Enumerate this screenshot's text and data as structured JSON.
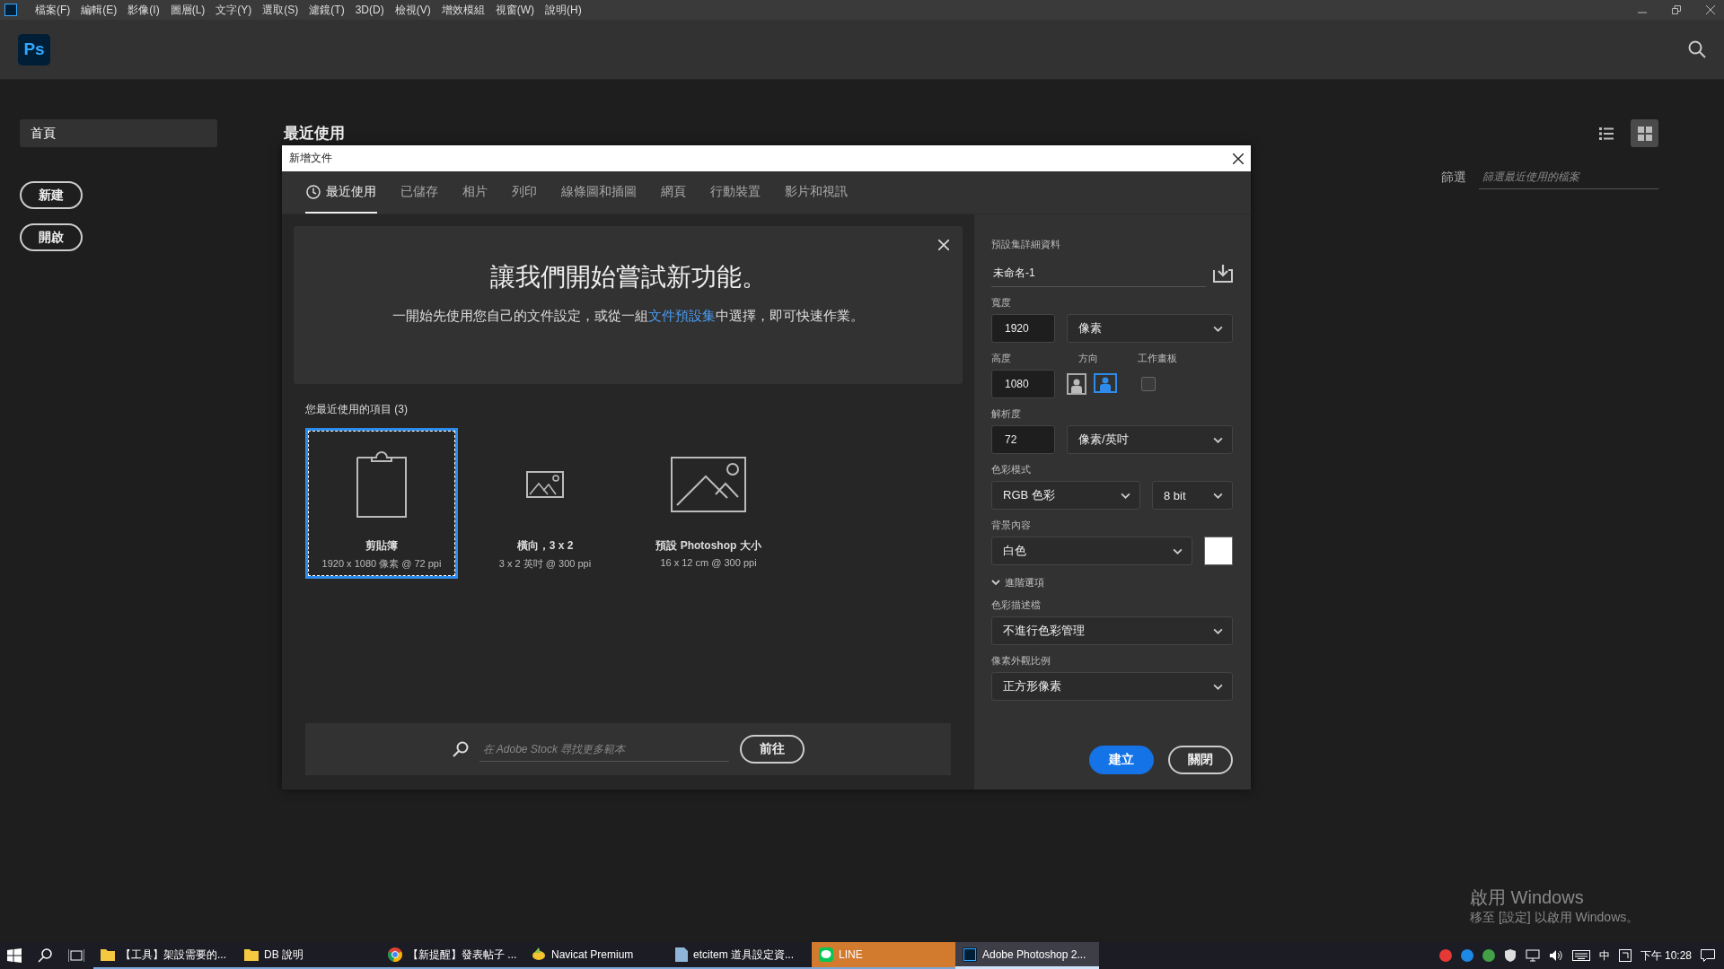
{
  "menu_bar": {
    "items": [
      "檔案(F)",
      "編輯(E)",
      "影像(I)",
      "圖層(L)",
      "文字(Y)",
      "選取(S)",
      "濾鏡(T)",
      "3D(D)",
      "檢視(V)",
      "增效模組",
      "視窗(W)",
      "說明(H)"
    ]
  },
  "header": {
    "logo": "Ps"
  },
  "sidebar": {
    "items": [
      {
        "label": "首頁",
        "selected": true
      }
    ],
    "buttons": [
      "新建",
      "開啟"
    ]
  },
  "home": {
    "title": "最近使用",
    "filter_label": "篩選",
    "filter_placeholder": "篩選最近使用的檔案",
    "view_modes": [
      {
        "kind": "list",
        "selected": false
      },
      {
        "kind": "grid",
        "selected": true
      }
    ]
  },
  "dialog": {
    "title": "新增文件",
    "tabs": [
      {
        "label": "最近使用",
        "selected": true,
        "kind": "clock"
      },
      {
        "label": "已儲存",
        "selected": false
      },
      {
        "label": "相片",
        "selected": false
      },
      {
        "label": "列印",
        "selected": false
      },
      {
        "label": "線條圖和插圖",
        "selected": false
      },
      {
        "label": "網頁",
        "selected": false
      },
      {
        "label": "行動裝置",
        "selected": false
      },
      {
        "label": "影片和視訊",
        "selected": false
      }
    ],
    "banner": {
      "heading": "讓我們開始嘗試新功能。",
      "text_before": "一開始先使用您自己的文件設定，或從一組",
      "link": "文件預設集",
      "text_after": "中選擇，即可快速作業。"
    },
    "recent": {
      "title": "您最近使用的項目 (3)",
      "items": [
        {
          "kind": "clipboard",
          "name": "剪貼簿",
          "detail": "1920 x 1080 像素 @ 72 ppi",
          "selected": true
        },
        {
          "kind": "small-image",
          "name": "橫向，3 x 2",
          "detail": "3 x 2 英吋 @ 300 ppi",
          "selected": false
        },
        {
          "kind": "large-image",
          "name": "預設 Photoshop 大小",
          "detail": "16 x 12 cm @ 300 ppi",
          "selected": false
        }
      ]
    },
    "stock_search": {
      "placeholder": "在 Adobe Stock 尋找更多範本",
      "button": "前往"
    },
    "preset": {
      "section_title": "預設集詳細資料",
      "name": "未命名-1",
      "width": {
        "label": "寬度",
        "value": "1920",
        "unit": "像素"
      },
      "height": {
        "label": "高度",
        "value": "1080"
      },
      "orientation": {
        "label": "方向",
        "options": [
          {
            "kind": "portrait",
            "selected": false
          },
          {
            "kind": "landscape",
            "selected": true
          }
        ]
      },
      "artboard": {
        "label": "工作畫板",
        "checked": false
      },
      "resolution": {
        "label": "解析度",
        "value": "72",
        "unit": "像素/英吋"
      },
      "color_mode": {
        "label": "色彩模式",
        "mode": "RGB 色彩",
        "depth": "8 bit"
      },
      "background": {
        "label": "背景內容",
        "value": "白色",
        "color": "#ffffff"
      },
      "advanced": {
        "label": "進階選項",
        "expanded": true
      },
      "color_profile": {
        "label": "色彩描述檔",
        "value": "不進行色彩管理"
      },
      "pixel_aspect": {
        "label": "像素外觀比例",
        "value": "正方形像素"
      }
    },
    "buttons": [
      {
        "label": "建立",
        "kind": "primary"
      },
      {
        "label": "關閉",
        "kind": "secondary"
      }
    ]
  },
  "activation_notice": {
    "title": "啟用 Windows",
    "body": "移至 [設定] 以啟用 Windows。"
  },
  "taskbar": {
    "apps": [
      {
        "label": "【工具】架設需要的...",
        "kind": "folder",
        "selected": false,
        "flashing": false
      },
      {
        "label": "DB 說明",
        "kind": "folder",
        "selected": false,
        "flashing": false
      },
      {
        "label": "【新提醒】發表帖子 ...",
        "kind": "chrome",
        "selected": false,
        "flashing": false
      },
      {
        "label": "Navicat Premium",
        "kind": "navicat",
        "selected": false,
        "flashing": false
      },
      {
        "label": "etcitem 道具設定資...",
        "kind": "doc",
        "selected": false,
        "flashing": false
      },
      {
        "label": "LINE",
        "kind": "line",
        "selected": false,
        "flashing": true
      },
      {
        "label": "Adobe Photoshop 2...",
        "kind": "ps",
        "selected": true,
        "flashing": false
      }
    ],
    "ime": "中",
    "clock": "下午 10:28"
  }
}
